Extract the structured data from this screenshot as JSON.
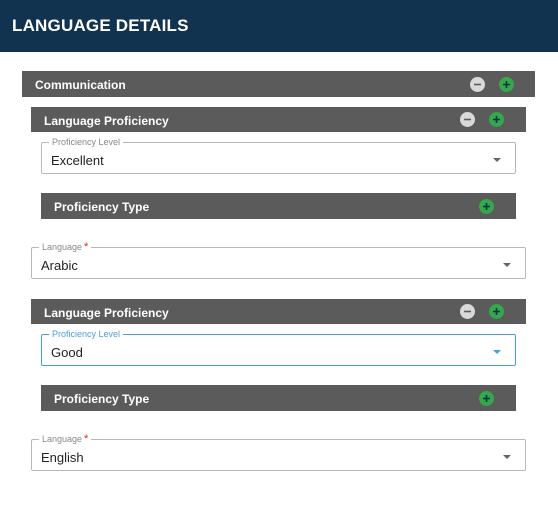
{
  "header": {
    "title": "LANGUAGE DETAILS"
  },
  "communication": {
    "title": "Communication"
  },
  "groups": [
    {
      "proficiency": {
        "title": "Language Proficiency",
        "level_label": "Proficiency Level",
        "level_value": "Excellent"
      },
      "proficiency_type": {
        "title": "Proficiency Type"
      },
      "language": {
        "label": "Language",
        "required_mark": "*",
        "value": "Arabic"
      }
    },
    {
      "proficiency": {
        "title": "Language Proficiency",
        "level_label": "Proficiency Level",
        "level_value": "Good"
      },
      "proficiency_type": {
        "title": "Proficiency Type"
      },
      "language": {
        "label": "Language",
        "required_mark": "*",
        "value": "English"
      }
    }
  ],
  "colors": {
    "header_bg": "#12334f",
    "bar_bg": "#5b5b5b",
    "add_green": "#35a84a",
    "remove_gray": "#d9d9d9",
    "focus_blue": "#4a9fd8",
    "required_red": "#e02020"
  },
  "icons": {
    "add": "plus-circle-icon",
    "remove": "minus-circle-icon",
    "dropdown": "caret-down-icon"
  }
}
